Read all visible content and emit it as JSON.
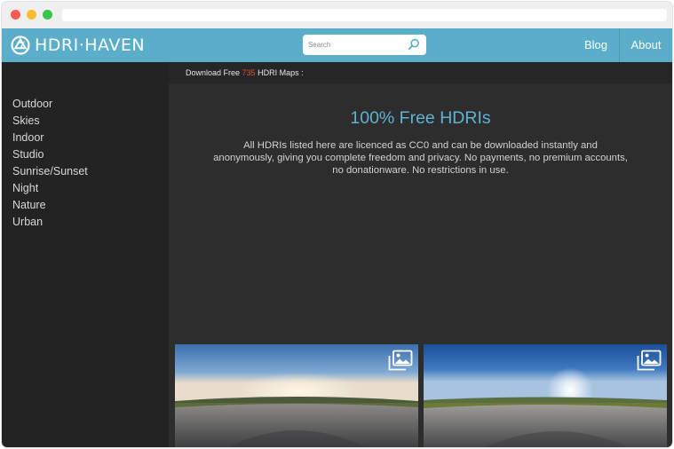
{
  "header": {
    "logo_text": "HDRI·HAVEN",
    "nav": {
      "blog": "Blog",
      "about": "About"
    }
  },
  "search": {
    "placeholder": "Search",
    "icon": "search-icon"
  },
  "download_bar": {
    "prefix": "Download Free ",
    "count": "735",
    "suffix": " HDRI Maps :"
  },
  "main": {
    "title": "100% Free HDRIs",
    "description": "All HDRIs listed here are licenced as CC0 and can be downloaded instantly and anonymously, giving you complete freedom and privacy. No payments, no premium accounts, no donationware. No restrictions in use."
  },
  "sidebar": {
    "categories": [
      "Outdoor",
      "Skies",
      "Indoor",
      "Studio",
      "Sunrise/Sunset",
      "Night",
      "Nature",
      "Urban"
    ]
  },
  "thumbnails": [
    {
      "icon": "image-icon"
    },
    {
      "icon": "image-icon"
    }
  ],
  "colors": {
    "header_bg": "#5aaec9",
    "accent": "#5fb2d1",
    "count_red": "#e14b3b",
    "sidebar_bg": "#232323",
    "main_bg": "#2d2d2d"
  }
}
